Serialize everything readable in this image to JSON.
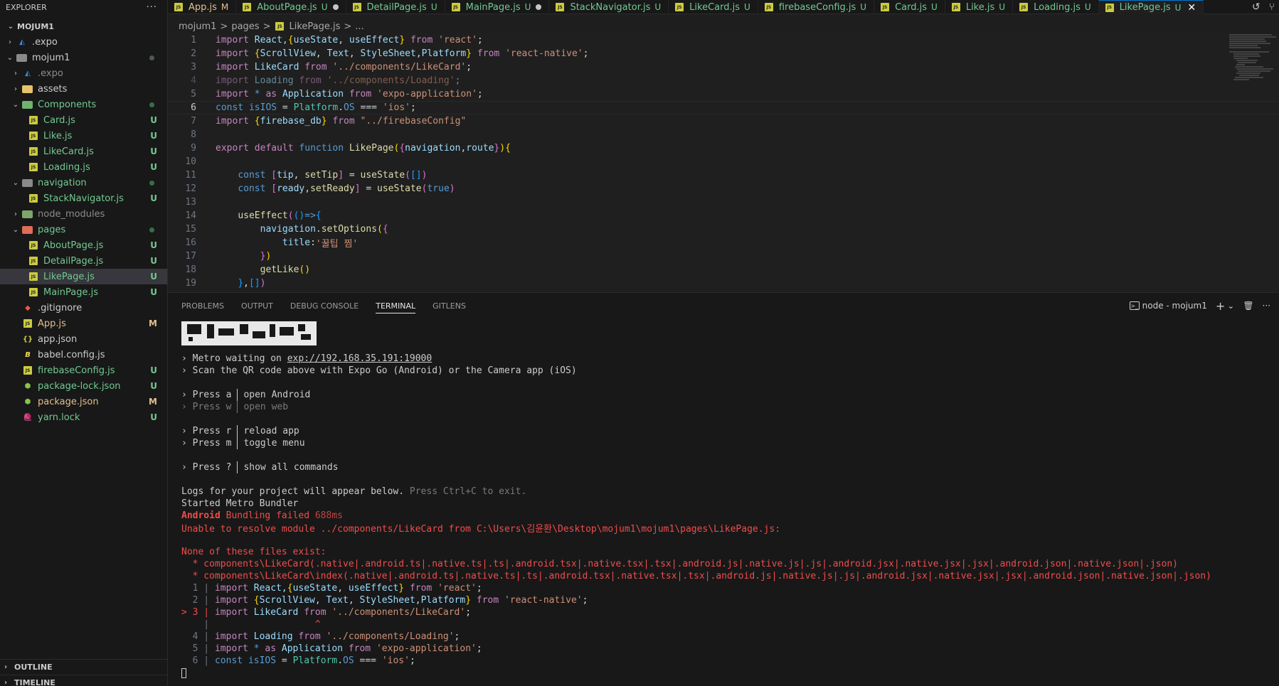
{
  "explorer": {
    "title": "EXPLORER",
    "more": "···",
    "root": "MOJUM1",
    "items": [
      {
        "label": ".expo",
        "badge": ""
      },
      {
        "label": "mojum1",
        "badge": ""
      },
      {
        "label": ".expo",
        "badge": ""
      },
      {
        "label": "assets",
        "badge": ""
      },
      {
        "label": "Components",
        "badge": ""
      },
      {
        "label": "Card.js",
        "badge": "U"
      },
      {
        "label": "Like.js",
        "badge": "U"
      },
      {
        "label": "LikeCard.js",
        "badge": "U"
      },
      {
        "label": "Loading.js",
        "badge": "U"
      },
      {
        "label": "navigation",
        "badge": ""
      },
      {
        "label": "StackNavigator.js",
        "badge": "U"
      },
      {
        "label": "node_modules",
        "badge": ""
      },
      {
        "label": "pages",
        "badge": ""
      },
      {
        "label": "AboutPage.js",
        "badge": "U"
      },
      {
        "label": "DetailPage.js",
        "badge": "U"
      },
      {
        "label": "LikePage.js",
        "badge": "U"
      },
      {
        "label": "MainPage.js",
        "badge": "U"
      },
      {
        "label": ".gitignore",
        "badge": ""
      },
      {
        "label": "App.js",
        "badge": "M"
      },
      {
        "label": "app.json",
        "badge": ""
      },
      {
        "label": "babel.config.js",
        "badge": ""
      },
      {
        "label": "firebaseConfig.js",
        "badge": "U"
      },
      {
        "label": "package-lock.json",
        "badge": "U"
      },
      {
        "label": "package.json",
        "badge": "M"
      },
      {
        "label": "yarn.lock",
        "badge": "U"
      }
    ],
    "outline": "OUTLINE",
    "timeline": "TIMELINE"
  },
  "tabs": [
    {
      "label": "App.js",
      "state": "M"
    },
    {
      "label": "AboutPage.js",
      "state": "U"
    },
    {
      "label": "DetailPage.js",
      "state": "U"
    },
    {
      "label": "MainPage.js",
      "state": "U"
    },
    {
      "label": "StackNavigator.js",
      "state": "U"
    },
    {
      "label": "LikeCard.js",
      "state": "U"
    },
    {
      "label": "firebaseConfig.js",
      "state": "U"
    },
    {
      "label": "Card.js",
      "state": "U"
    },
    {
      "label": "Like.js",
      "state": "U"
    },
    {
      "label": "Loading.js",
      "state": "U"
    },
    {
      "label": "LikePage.js",
      "state": "U"
    }
  ],
  "breadcrumb": {
    "part1": "mojum1",
    "part2": "pages",
    "part3": "LikePage.js",
    "part4": "...",
    "sep": ">"
  },
  "editor": {
    "line_numbers": [
      "1",
      "2",
      "3",
      "4",
      "5",
      "6",
      "7",
      "8",
      "9",
      "10",
      "11",
      "12",
      "13",
      "14",
      "15",
      "16",
      "17",
      "18",
      "19"
    ],
    "tokens": {
      "import": "import",
      "from": "from",
      "const": "const",
      "export": "export",
      "default": "default",
      "function": "function",
      "as": "as",
      "true": "true",
      "react_names": "React,",
      "useState": "useState",
      "useEffect": "useEffect",
      "react_str": "'react'",
      "ScrollView": "ScrollView",
      "Text": "Text",
      "StyleSheet": "StyleSheet",
      "Platform": "Platform",
      "rn_str": "'react-native'",
      "LikeCard": "LikeCard",
      "likecard_str": "'../components/LikeCard'",
      "Loading": "Loading",
      "loading_str": "'../components/Loading'",
      "star": "*",
      "Application": "Application",
      "app_str": "'expo-application'",
      "isIOS": "isIOS",
      "OS": "OS",
      "ios_str": "'ios'",
      "firebase_db": "firebase_db",
      "fb_str": "\"../firebaseConfig\"",
      "LikePage": "LikePage",
      "navigation": "navigation",
      "route": "route",
      "tip": "tip",
      "setTip": "setTip",
      "ready": "ready",
      "setReady": "setReady",
      "setOptions": "setOptions",
      "title": "title",
      "title_str": "'꿀팁 찜'",
      "getLike": "getLike"
    }
  },
  "panel": {
    "tabs": [
      "PROBLEMS",
      "OUTPUT",
      "DEBUG CONSOLE",
      "TERMINAL",
      "GITLENS"
    ],
    "active_tab": "TERMINAL",
    "terminal_name": "node - mojum1",
    "add": "+",
    "dropdown": "⌄",
    "trash": "🗑",
    "more": "···"
  },
  "terminal": {
    "metro_waiting": "› Metro waiting on ",
    "metro_url": "exp://192.168.35.191:19000",
    "scan": "› Scan the QR code above with Expo Go (Android) or the Camera app (iOS)",
    "press_a": "› Press a",
    "open_android": "open Android",
    "press_w": "› Press w",
    "open_web": "open web",
    "press_r": "› Press r",
    "reload_app": "reload app",
    "press_m": "› Press m",
    "toggle_menu": "toggle menu",
    "press_q": "› Press ?",
    "show_all": "show all commands",
    "logs": "Logs for your project will appear below. ",
    "ctrl_c": "Press Ctrl+C to exit.",
    "started": "Started Metro Bundler",
    "android": "Android",
    "bundling_failed": " Bundling failed ",
    "ms": "688ms",
    "unable": "Unable to resolve module ../components/LikeCard from C:\\Users\\김윤환\\Desktop\\mojum1\\mojum1\\pages\\LikePage.js:",
    "none_exist": "None of these files exist:",
    "file1": "  * components\\LikeCard(.native|.android.ts|.native.ts|.ts|.android.tsx|.native.tsx|.tsx|.android.js|.native.js|.js|.android.jsx|.native.jsx|.jsx|.android.json|.native.json|.json)",
    "file2": "  * components\\LikeCard\\index(.native|.android.ts|.native.ts|.ts|.android.tsx|.native.tsx|.tsx|.android.js|.native.js|.js|.android.jsx|.native.jsx|.jsx|.android.json|.native.json|.json)",
    "ctx_ln1": "  1 | ",
    "ctx_ln2": "  2 | ",
    "ctx_ln3": "> 3 | ",
    "ctx_caret_ln": "    | ",
    "caret": "                  ^",
    "ctx_ln4": "  4 | ",
    "ctx_ln5": "  5 | ",
    "ctx_ln6": "  6 | "
  }
}
